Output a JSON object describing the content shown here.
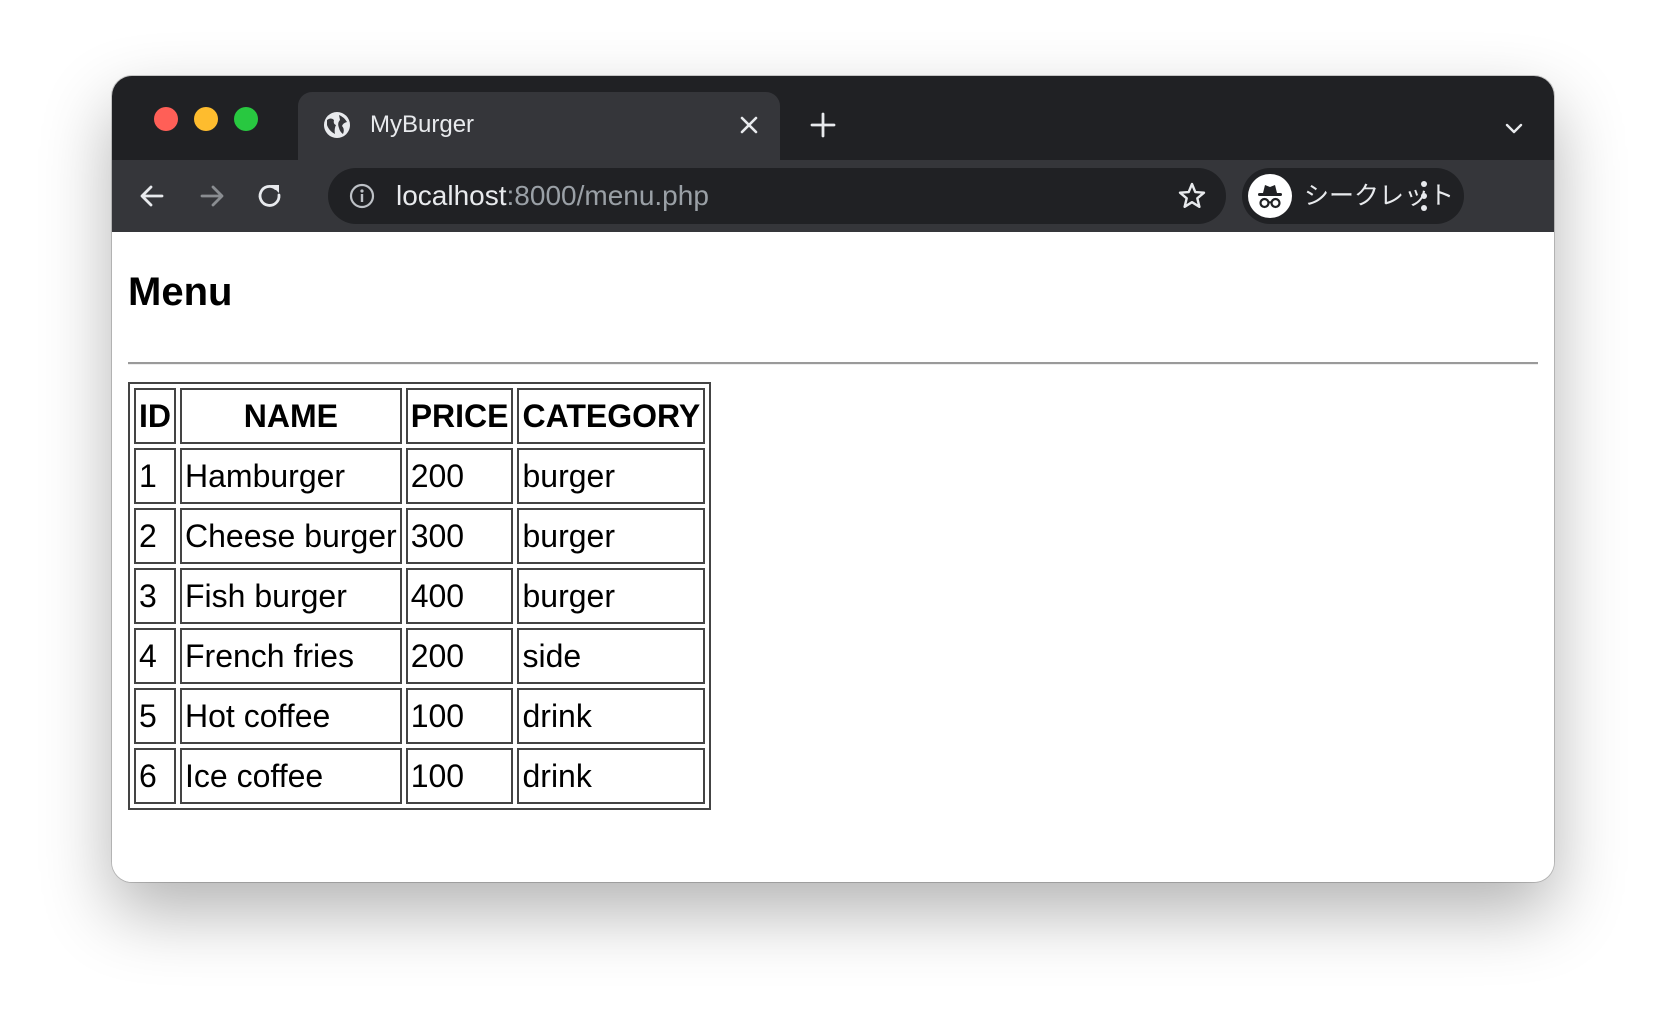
{
  "browser": {
    "tab_title": "MyBurger",
    "url_host": "localhost",
    "url_rest": ":8000/menu.php",
    "incognito_label": "シークレット"
  },
  "page": {
    "title": "Menu",
    "table": {
      "headers": [
        "ID",
        "NAME",
        "PRICE",
        "CATEGORY"
      ],
      "rows": [
        [
          "1",
          "Hamburger",
          "200",
          "burger"
        ],
        [
          "2",
          "Cheese burger",
          "300",
          "burger"
        ],
        [
          "3",
          "Fish burger",
          "400",
          "burger"
        ],
        [
          "4",
          "French fries",
          "200",
          "side"
        ],
        [
          "5",
          "Hot coffee",
          "100",
          "drink"
        ],
        [
          "6",
          "Ice coffee",
          "100",
          "drink"
        ]
      ]
    }
  },
  "icons": {
    "favicon": "globe-icon",
    "tab_close": "close-icon",
    "new_tab": "plus-icon",
    "tab_search": "chevron-down-icon",
    "back": "arrow-left-icon",
    "forward": "arrow-right-icon",
    "reload": "reload-icon",
    "site_info": "info-icon",
    "bookmark": "star-icon",
    "incognito": "incognito-icon",
    "menu": "kebab-menu-icon"
  },
  "colors": {
    "titlebar": "#202124",
    "toolbar": "#35363a",
    "close": "#ff5f57",
    "minimize": "#febc2e",
    "zoom": "#28c840"
  }
}
